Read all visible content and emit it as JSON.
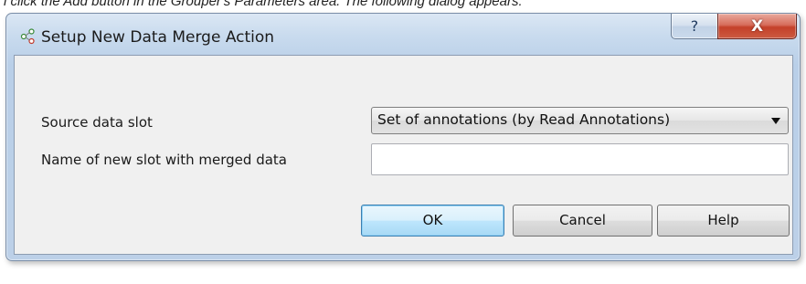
{
  "header_text": "l click the Add button in the Grouper's Parameters area. The following dialog appears:",
  "dialog": {
    "title": "Setup New Data Merge Action",
    "help_glyph": "?",
    "close_glyph": "X"
  },
  "form": {
    "source_label": "Source data slot",
    "source_value": "Set of annotations (by Read Annotations)",
    "name_label": "Name of new slot with merged data",
    "name_value": ""
  },
  "buttons": {
    "ok": "OK",
    "cancel": "Cancel",
    "help": "Help"
  },
  "icons": {
    "app": "grouper-nodes-icon",
    "dropdown": "chevron-down-icon"
  },
  "colors": {
    "close_button": "#c4412a",
    "ok_button_border": "#3c7fb1"
  }
}
